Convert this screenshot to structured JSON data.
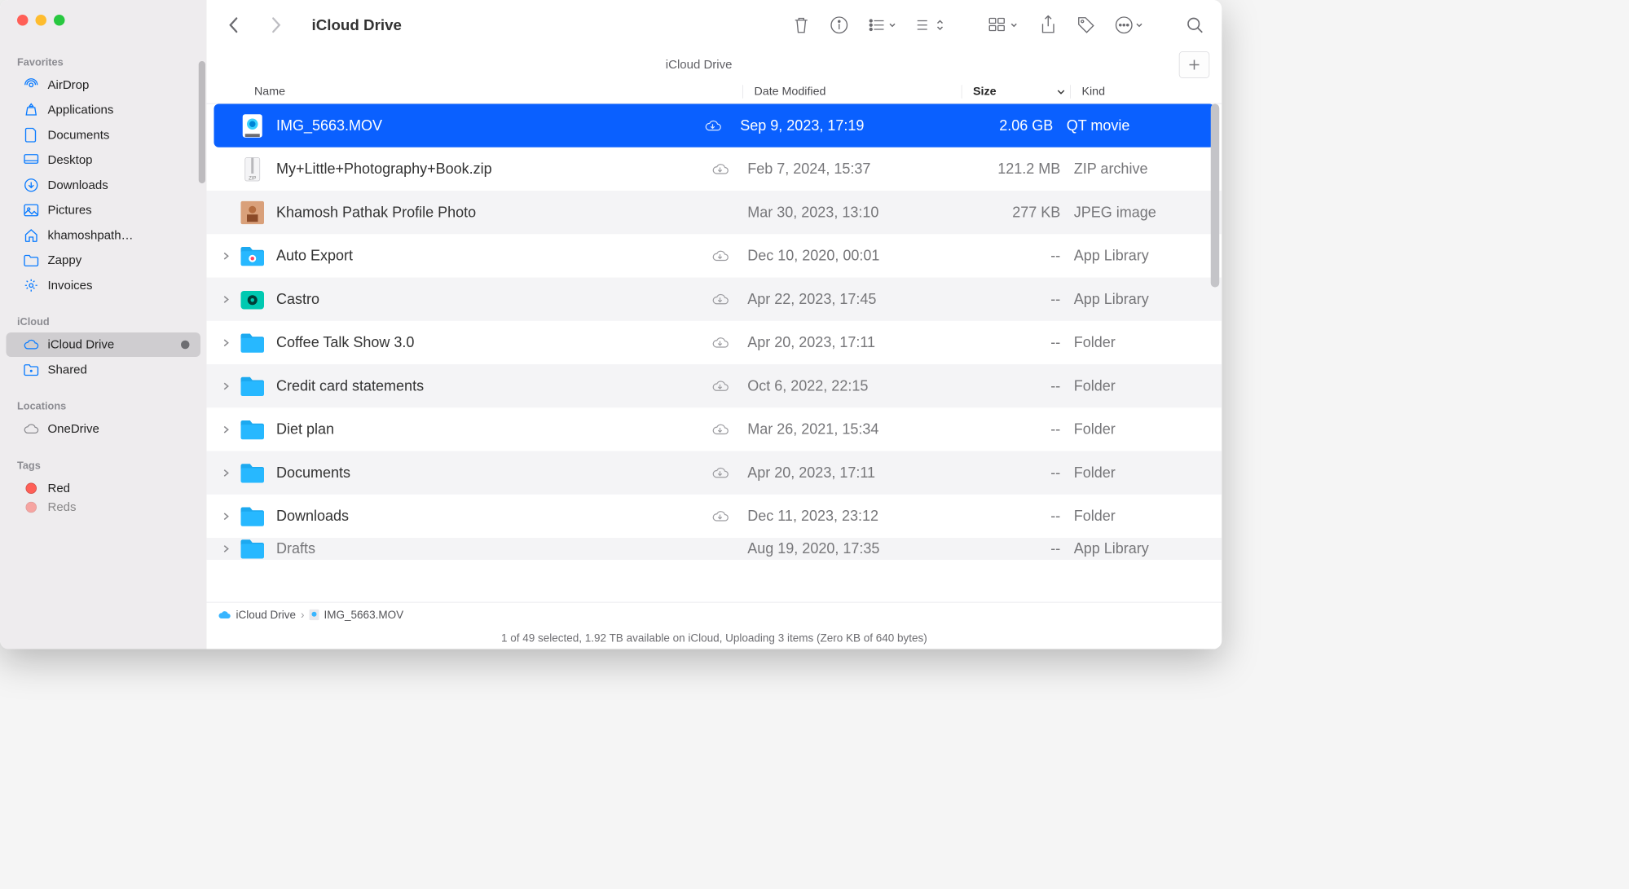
{
  "window_title": "iCloud Drive",
  "path_header": "iCloud Drive",
  "sidebar": {
    "sections": [
      {
        "title": "Favorites",
        "items": [
          {
            "icon": "airdrop-icon",
            "label": "AirDrop"
          },
          {
            "icon": "applications-icon",
            "label": "Applications"
          },
          {
            "icon": "documents-icon",
            "label": "Documents"
          },
          {
            "icon": "desktop-icon",
            "label": "Desktop"
          },
          {
            "icon": "downloads-icon",
            "label": "Downloads"
          },
          {
            "icon": "pictures-icon",
            "label": "Pictures"
          },
          {
            "icon": "home-icon",
            "label": "khamoshpath…"
          },
          {
            "icon": "folder-icon",
            "label": "Zappy"
          },
          {
            "icon": "gear-icon",
            "label": "Invoices"
          }
        ]
      },
      {
        "title": "iCloud",
        "items": [
          {
            "icon": "cloud-icon",
            "label": "iCloud Drive",
            "selected": true,
            "status_dot": true
          },
          {
            "icon": "shared-folder-icon",
            "label": "Shared"
          }
        ]
      },
      {
        "title": "Locations",
        "items": [
          {
            "icon": "cloud-outline-icon",
            "label": "OneDrive"
          }
        ]
      },
      {
        "title": "Tags",
        "items": [
          {
            "icon": "tag-dot-red",
            "label": "Red"
          },
          {
            "icon": "tag-dot-red",
            "label": "Reds"
          }
        ]
      }
    ]
  },
  "columns": {
    "name": "Name",
    "date": "Date Modified",
    "size": "Size",
    "kind": "Kind"
  },
  "files": [
    {
      "name": "IMG_5663.MOV",
      "date": "Sep 9, 2023, 17:19",
      "size": "2.06 GB",
      "kind": "QT movie",
      "icon": "quicktime",
      "cloud": true,
      "selected": true
    },
    {
      "name": "My+Little+Photography+Book.zip",
      "date": "Feb 7, 2024, 15:37",
      "size": "121.2 MB",
      "kind": "ZIP archive",
      "icon": "zip",
      "cloud": true
    },
    {
      "name": "Khamosh Pathak Profile Photo",
      "date": "Mar 30, 2023, 13:10",
      "size": "277 KB",
      "kind": "JPEG image",
      "icon": "jpeg"
    },
    {
      "name": "Auto Export",
      "date": "Dec 10, 2020, 00:01",
      "size": "--",
      "kind": "App Library",
      "icon": "app-photos",
      "cloud": true,
      "disclosure": true
    },
    {
      "name": "Castro",
      "date": "Apr 22, 2023, 17:45",
      "size": "--",
      "kind": "App Library",
      "icon": "app-castro",
      "cloud": true,
      "disclosure": true
    },
    {
      "name": "Coffee Talk Show 3.0",
      "date": "Apr 20, 2023, 17:11",
      "size": "--",
      "kind": "Folder",
      "icon": "folder",
      "cloud": true,
      "disclosure": true
    },
    {
      "name": "Credit card statements",
      "date": "Oct 6, 2022, 22:15",
      "size": "--",
      "kind": "Folder",
      "icon": "folder",
      "cloud": true,
      "disclosure": true
    },
    {
      "name": "Diet plan",
      "date": "Mar 26, 2021, 15:34",
      "size": "--",
      "kind": "Folder",
      "icon": "folder",
      "cloud": true,
      "disclosure": true
    },
    {
      "name": "Documents",
      "date": "Apr 20, 2023, 17:11",
      "size": "--",
      "kind": "Folder",
      "icon": "folder",
      "cloud": true,
      "disclosure": true
    },
    {
      "name": "Downloads",
      "date": "Dec 11, 2023, 23:12",
      "size": "--",
      "kind": "Folder",
      "icon": "folder",
      "cloud": true,
      "disclosure": true
    },
    {
      "name": "Drafts",
      "date": "Aug 19, 2020, 17:35",
      "size": "--",
      "kind": "App Library",
      "icon": "app-drafts",
      "disclosure": true
    }
  ],
  "path_bar": {
    "segments": [
      "iCloud Drive",
      "IMG_5663.MOV"
    ]
  },
  "status_bar": "1 of 49 selected, 1.92 TB available on iCloud, Uploading 3 items (Zero KB of 640 bytes)"
}
